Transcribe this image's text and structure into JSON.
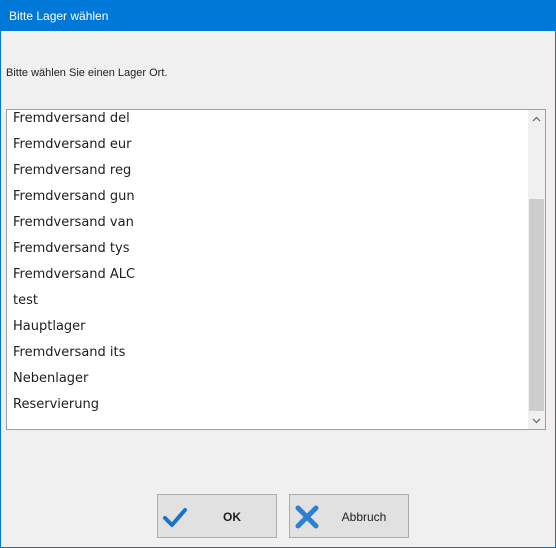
{
  "window": {
    "title": "Bitte Lager wählen"
  },
  "dialog": {
    "prompt": "Bitte wählen Sie einen Lager Ort.",
    "items": [
      "Fremdversand del",
      "Fremdversand eur",
      "Fremdversand reg",
      "Fremdversand gun",
      "Fremdversand van",
      "Fremdversand tys",
      "Fremdversand ALC",
      "test",
      "Hauptlager",
      "Fremdversand its",
      "Nebenlager",
      "Reservierung"
    ]
  },
  "buttons": {
    "ok": {
      "label": "OK",
      "icon": "checkmark-icon",
      "color": "#1a73c9"
    },
    "cancel": {
      "label": "Abbruch",
      "icon": "x-icon",
      "color": "#2f7fd0"
    }
  },
  "colors": {
    "titlebar": "#0078d7",
    "client": "#f0f0f0"
  }
}
